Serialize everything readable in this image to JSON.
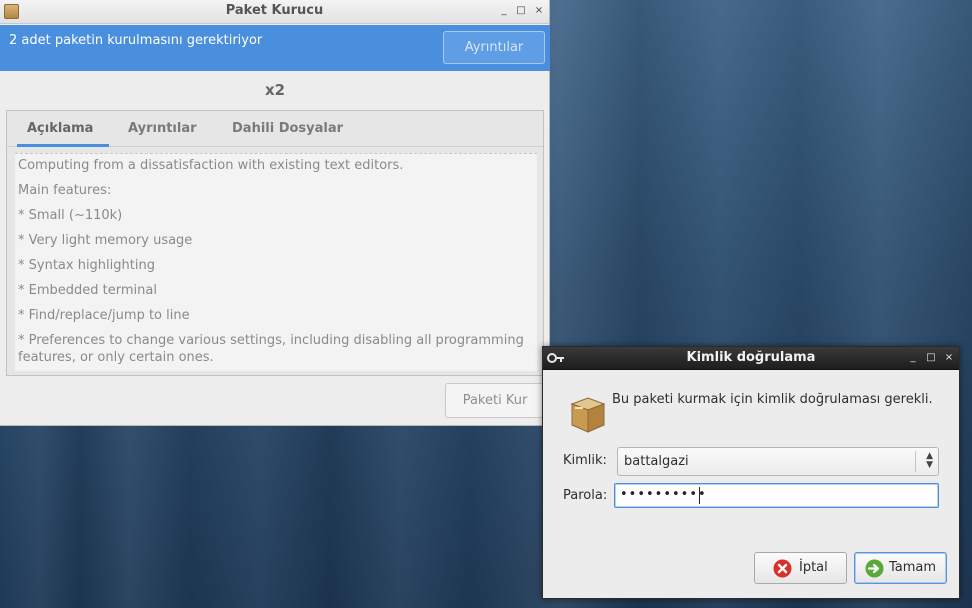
{
  "installer": {
    "title": "Paket Kurucu",
    "info_message": "2 adet paketin kurulmasını gerektiriyor",
    "details_button": "Ayrıntılar",
    "package_name": "x2",
    "tabs": [
      {
        "label": "Açıklama",
        "active": true
      },
      {
        "label": "Ayrıntılar",
        "active": false
      },
      {
        "label": "Dahili Dosyalar",
        "active": false
      }
    ],
    "description": [
      "Computing from a dissatisfaction with existing text editors.",
      "Main features:",
      "* Small (~110k)",
      "* Very light memory usage",
      "* Syntax highlighting",
      "* Embedded terminal",
      "* Find/replace/jump to line",
      "* Preferences to change various settings, including disabling all programming features, or only certain ones."
    ],
    "install_button": "Paketi Kur",
    "window_controls": [
      "_",
      "□",
      "×"
    ]
  },
  "auth_dialog": {
    "title": "Kimlik doğrulama",
    "message": "Bu paketi kurmak için kimlik doğrulaması gerekli.",
    "identity_label": "Kimlik:",
    "identity_value": "battalgazi",
    "password_label": "Parola:",
    "password_masked": "••••••••••",
    "cancel_button": "İptal",
    "ok_button": "Tamam",
    "window_controls": [
      "_",
      "□",
      "×"
    ]
  },
  "colors": {
    "accent": "#4a8fde",
    "desktop": "#2c4d6e"
  }
}
